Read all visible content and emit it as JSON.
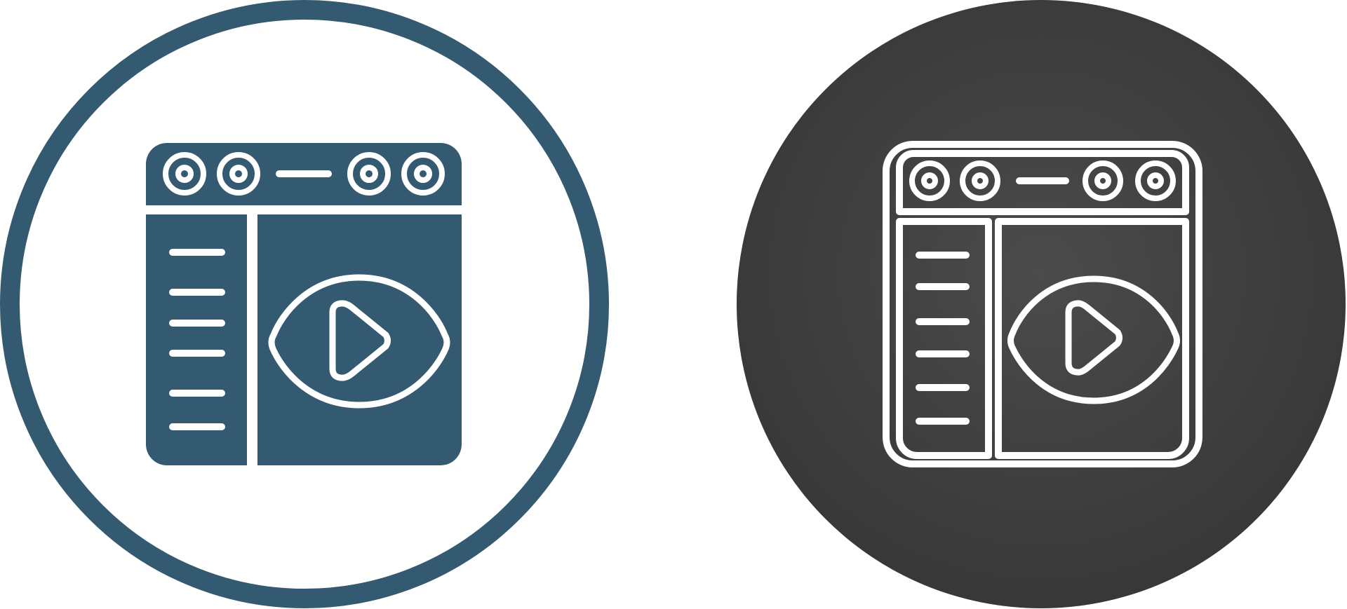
{
  "icons": [
    {
      "name": "video-player-icon-glyph",
      "style": "glyph",
      "primary_color": "#335A71",
      "background_color": "#FFFFFF",
      "ring_color": "#335A71",
      "detail_color": "#FFFFFF"
    },
    {
      "name": "video-player-icon-outline",
      "style": "outline",
      "primary_color": "#FFFFFF",
      "background_gradient": [
        "#4A4A4A",
        "#353535"
      ],
      "detail_color": "#FFFFFF"
    }
  ]
}
